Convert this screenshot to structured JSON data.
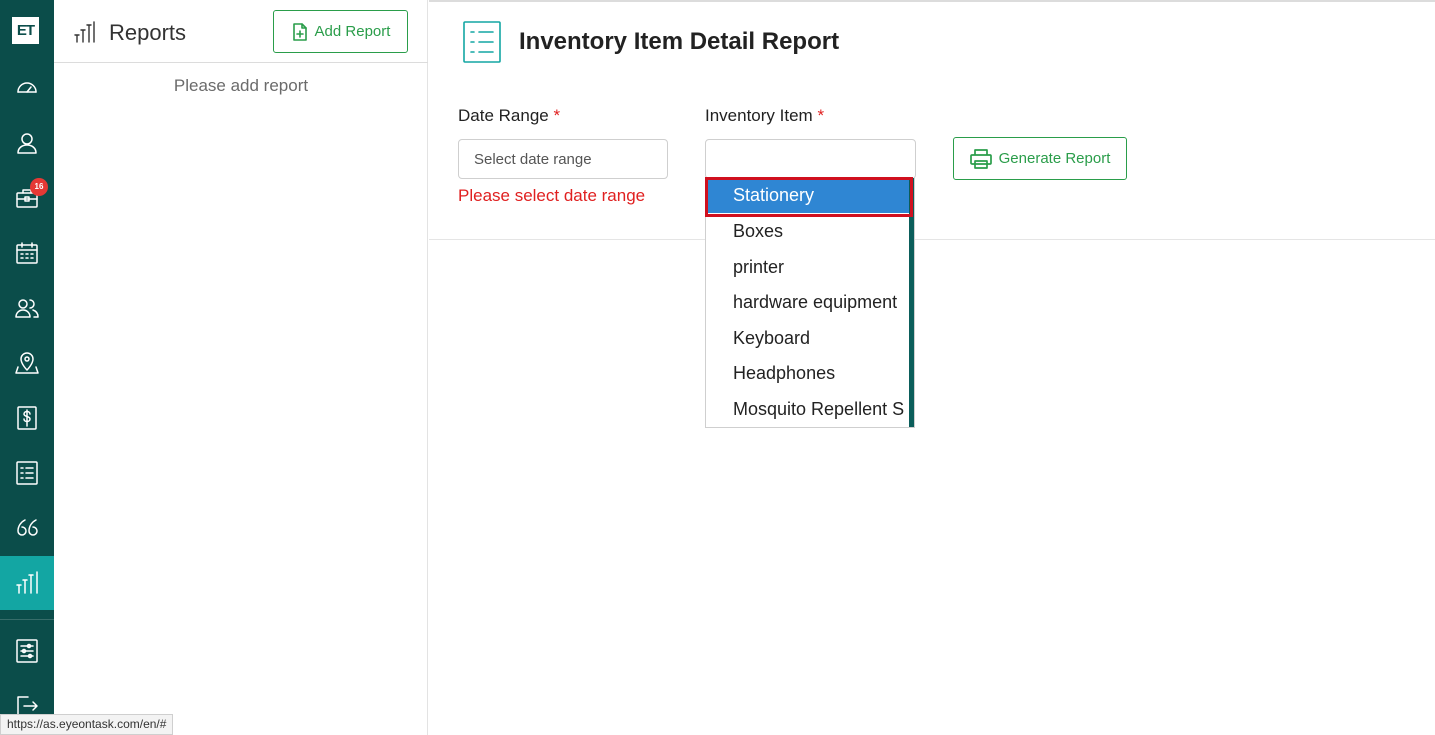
{
  "app": {
    "logo_text": "ET"
  },
  "rail": {
    "items": [
      {
        "icon": "dashboard-gauge-icon"
      },
      {
        "icon": "user-icon"
      },
      {
        "icon": "briefcase-icon",
        "badge": "16"
      },
      {
        "icon": "calendar-icon"
      },
      {
        "icon": "team-icon"
      },
      {
        "icon": "map-location-icon"
      },
      {
        "icon": "dollar-icon"
      },
      {
        "icon": "list-icon"
      },
      {
        "icon": "quote-icon"
      },
      {
        "icon": "reports-bars-icon",
        "active": true
      },
      {
        "icon": "settings-sliders-icon"
      },
      {
        "icon": "logout-icon"
      }
    ]
  },
  "reports_panel": {
    "title": "Reports",
    "add_button_label": "Add Report",
    "empty_message": "Please add report"
  },
  "main": {
    "title": "Inventory Item Detail Report",
    "date_range": {
      "label": "Date Range",
      "required_mark": "*",
      "placeholder": "Select date range",
      "error": "Please select date range"
    },
    "inventory_item": {
      "label": "Inventory Item",
      "required_mark": "*",
      "value": "",
      "options": [
        "Stationery",
        "Boxes",
        "printer",
        "hardware equipment",
        "Keyboard",
        "Headphones",
        "Mosquito Repellent S"
      ],
      "highlighted": "Stationery"
    },
    "generate_button_label": "Generate Report"
  },
  "status_bar": {
    "url": "https://as.eyeontask.com/en/#"
  },
  "colors": {
    "rail_bg": "#0b4d4a",
    "rail_active": "#13a6a3",
    "accent_green": "#2a9d4a",
    "error_red": "#e02020",
    "selected_blue": "#2f86d3"
  }
}
